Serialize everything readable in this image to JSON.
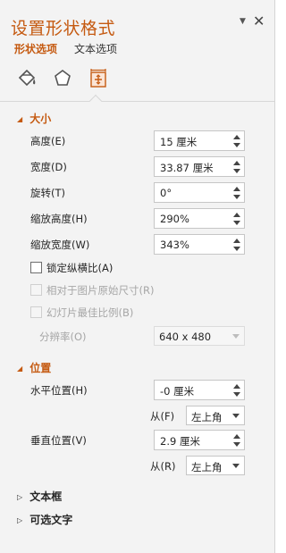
{
  "pane": {
    "title": "设置形状格式",
    "close_glyph": "✕",
    "dropdown_glyph": "▼"
  },
  "tabs": {
    "shape": "形状选项",
    "text": "文本选项"
  },
  "icon_tabs": [
    "fill-line-icon",
    "effects-icon",
    "size-properties-icon"
  ],
  "colors": {
    "accent": "#c55a11",
    "pane_bg": "#f3f3f3"
  },
  "size_section": {
    "header": "大小",
    "height_label": "高度(E)",
    "height_value": "15 厘米",
    "width_label": "宽度(D)",
    "width_value": "33.87 厘米",
    "rotation_label": "旋转(T)",
    "rotation_value": "0°",
    "scale_height_label": "缩放高度(H)",
    "scale_height_value": "290%",
    "scale_width_label": "缩放宽度(W)",
    "scale_width_value": "343%",
    "lock_aspect_label": "锁定纵横比(A)",
    "relative_original_label": "相对于图片原始尺寸(R)",
    "best_scale_label": "幻灯片最佳比例(B)",
    "resolution_label": "分辨率(O)",
    "resolution_value": "640 x 480"
  },
  "position_section": {
    "header": "位置",
    "horizontal_label": "水平位置(H)",
    "horizontal_value": "-0 厘米",
    "from_label_h": "从(F)",
    "from_value_h": "左上角",
    "vertical_label": "垂直位置(V)",
    "vertical_value": "2.9 厘米",
    "from_label_v": "从(R)",
    "from_value_v": "左上角"
  },
  "collapsed_sections": {
    "textbox": "文本框",
    "alt_text": "可选文字"
  }
}
